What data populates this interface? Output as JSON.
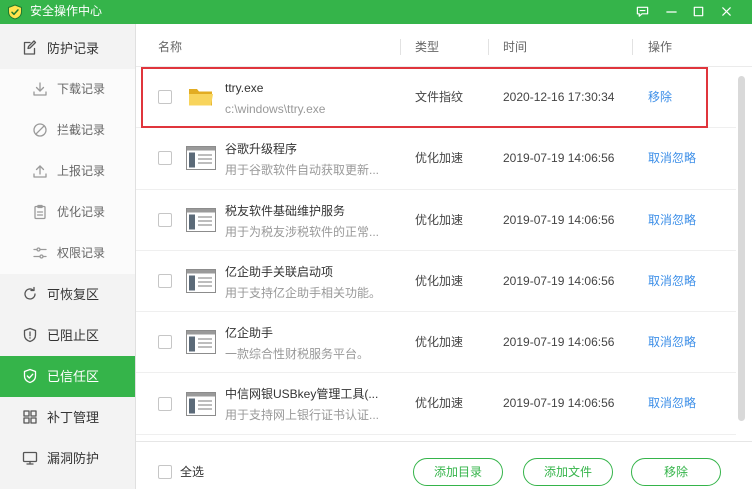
{
  "window": {
    "title": "安全操作中心",
    "logo_icon": "security-center-logo-icon",
    "accent_color": "#35b44a",
    "highlight_color": "#e0353c",
    "link_color": "#3d8fe8"
  },
  "titlebar": {
    "controls": [
      {
        "icon": "feedback-icon"
      },
      {
        "icon": "minimize-icon"
      },
      {
        "icon": "maximize-icon"
      },
      {
        "icon": "close-icon"
      }
    ]
  },
  "sidebar": {
    "items": [
      {
        "label": "防护记录",
        "icon": "record-icon",
        "sub": false,
        "selected": false
      },
      {
        "label": "下载记录",
        "icon": "download-icon",
        "sub": true,
        "selected": false
      },
      {
        "label": "拦截记录",
        "icon": "block-icon",
        "sub": true,
        "selected": false
      },
      {
        "label": "上报记录",
        "icon": "upload-icon",
        "sub": true,
        "selected": false
      },
      {
        "label": "优化记录",
        "icon": "clipboard-icon",
        "sub": true,
        "selected": false
      },
      {
        "label": "权限记录",
        "icon": "sliders-icon",
        "sub": true,
        "selected": false
      },
      {
        "label": "可恢复区",
        "icon": "restore-icon",
        "sub": false,
        "selected": false
      },
      {
        "label": "已阻止区",
        "icon": "shield-alert-icon",
        "sub": false,
        "selected": false
      },
      {
        "label": "已信任区",
        "icon": "shield-check-icon",
        "sub": false,
        "selected": true
      },
      {
        "label": "补丁管理",
        "icon": "patch-grid-icon",
        "sub": false,
        "selected": false
      },
      {
        "label": "漏洞防护",
        "icon": "monitor-icon",
        "sub": false,
        "selected": false
      }
    ]
  },
  "table": {
    "columns": {
      "name": "名称",
      "type": "类型",
      "time": "时间",
      "action": "操作"
    },
    "rows": [
      {
        "icon": "folder-icon",
        "name": "ttry.exe",
        "desc": "c:\\windows\\ttry.exe",
        "type": "文件指纹",
        "time": "2020-12-16 17:30:34",
        "action": "移除",
        "checked": false,
        "highlighted": true
      },
      {
        "icon": "app-window-icon",
        "name": "谷歌升级程序",
        "desc": "用于谷歌软件自动获取更新...",
        "type": "优化加速",
        "time": "2019-07-19 14:06:56",
        "action": "取消忽略",
        "checked": false,
        "highlighted": false
      },
      {
        "icon": "app-window-icon",
        "name": "税友软件基础维护服务",
        "desc": "用于为税友涉税软件的正常...",
        "type": "优化加速",
        "time": "2019-07-19 14:06:56",
        "action": "取消忽略",
        "checked": false,
        "highlighted": false
      },
      {
        "icon": "app-window-icon",
        "name": "亿企助手关联启动项",
        "desc": "用于支持亿企助手相关功能。",
        "type": "优化加速",
        "time": "2019-07-19 14:06:56",
        "action": "取消忽略",
        "checked": false,
        "highlighted": false
      },
      {
        "icon": "app-window-icon",
        "name": "亿企助手",
        "desc": "一款综合性财税服务平台。",
        "type": "优化加速",
        "time": "2019-07-19 14:06:56",
        "action": "取消忽略",
        "checked": false,
        "highlighted": false
      },
      {
        "icon": "app-window-icon",
        "name": "中信网银USBkey管理工具(...",
        "desc": "用于支持网上银行证书认证...",
        "type": "优化加速",
        "time": "2019-07-19 14:06:56",
        "action": "取消忽略",
        "checked": false,
        "highlighted": false
      }
    ]
  },
  "footer": {
    "select_all_label": "全选",
    "select_all_checked": false,
    "add_folder_label": "添加目录",
    "add_file_label": "添加文件",
    "remove_label": "移除"
  }
}
